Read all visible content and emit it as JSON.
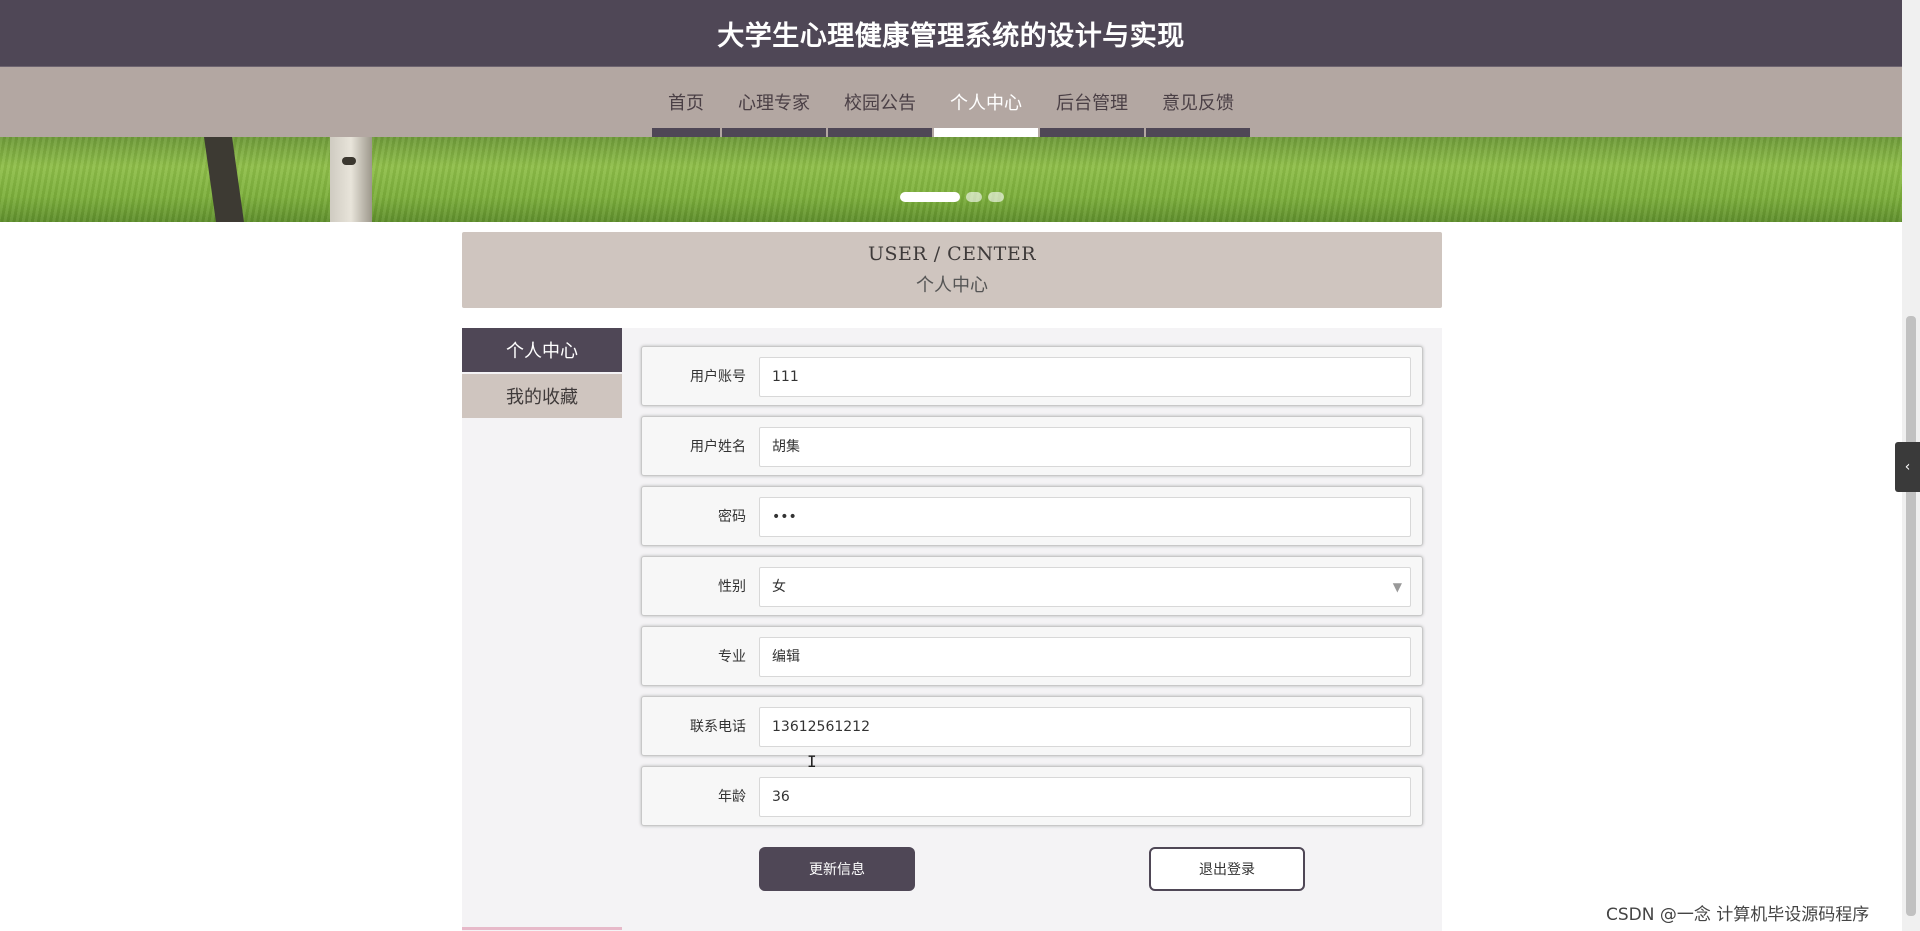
{
  "header": {
    "title": "大学生心理健康管理系统的设计与实现"
  },
  "nav": {
    "items": [
      {
        "label": "首页",
        "active": false
      },
      {
        "label": "心理专家",
        "active": false
      },
      {
        "label": "校园公告",
        "active": false
      },
      {
        "label": "个人中心",
        "active": true
      },
      {
        "label": "后台管理",
        "active": false
      },
      {
        "label": "意见反馈",
        "active": false
      }
    ]
  },
  "banner": {
    "slides": 3,
    "active_slide": 1
  },
  "section": {
    "en_title": "USER / CENTER",
    "zh_title": "个人中心"
  },
  "sidebar": {
    "items": [
      {
        "label": "个人中心",
        "active": true
      },
      {
        "label": "我的收藏",
        "active": false
      }
    ]
  },
  "form": {
    "account_label": "用户账号",
    "account_value": "111",
    "name_label": "用户姓名",
    "name_value": "胡集",
    "password_label": "密码",
    "password_value": "•••",
    "gender_label": "性别",
    "gender_value": "女",
    "major_label": "专业",
    "major_value": "编辑",
    "phone_label": "联系电话",
    "phone_value": "13612561212",
    "age_label": "年龄",
    "age_value": "36"
  },
  "buttons": {
    "update": "更新信息",
    "logout": "退出登录"
  },
  "watermark": "CSDN @一念 计算机毕设源码程序",
  "colors": {
    "primary": "#4f4756",
    "nav_bg": "#b3a7a2",
    "title_band": "#cfc5bf"
  }
}
